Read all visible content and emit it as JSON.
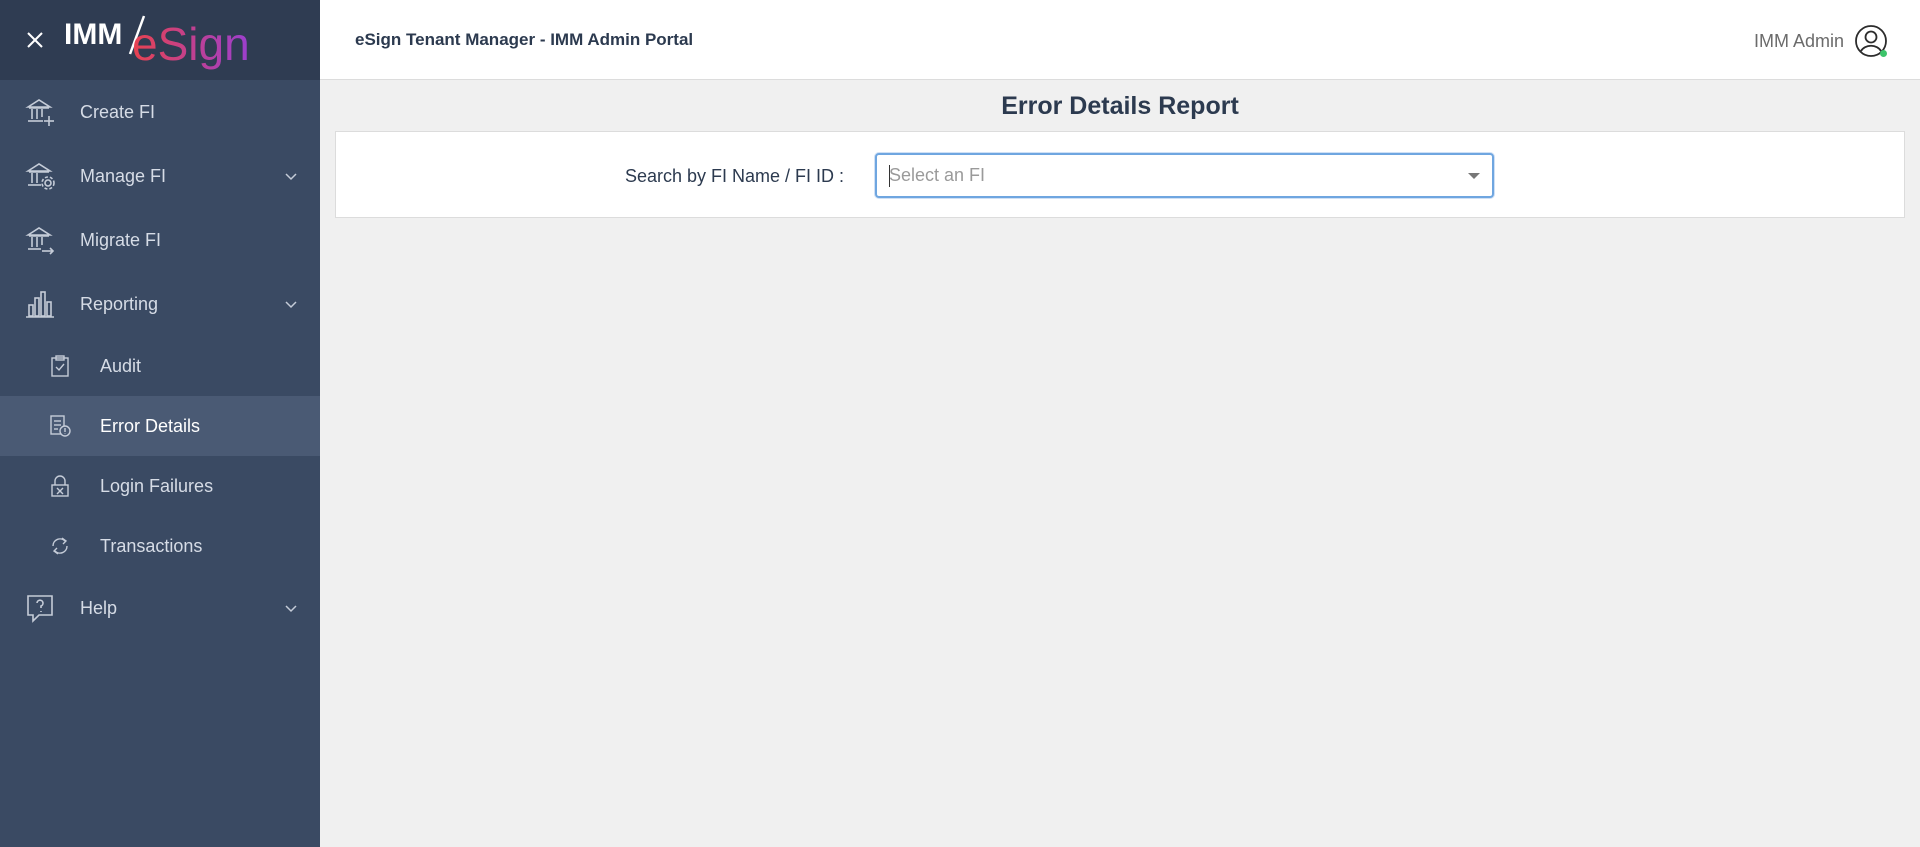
{
  "brand": {
    "part1": "IMM",
    "part2": "eSign",
    "accent_gradient": [
      "#e8424f",
      "#9b3fcf"
    ]
  },
  "colors": {
    "sidebar_bg": "#3a4a63",
    "sidebar_header_bg": "#2f3c52",
    "active_item_bg": "#4a5a74",
    "focus_border": "#6fa6e0",
    "online": "#3cc46a"
  },
  "sidebar": {
    "items": [
      {
        "label": "Create FI",
        "icon": "bank-plus-icon"
      },
      {
        "label": "Manage FI",
        "icon": "bank-gear-icon",
        "expandable": true
      },
      {
        "label": "Migrate FI",
        "icon": "bank-arrow-icon"
      },
      {
        "label": "Reporting",
        "icon": "bar-chart-icon",
        "expandable": true
      },
      {
        "label": "Help",
        "icon": "help-bubble-icon",
        "expandable": true
      }
    ],
    "reporting_subitems": [
      {
        "label": "Audit",
        "icon": "clipboard-check-icon"
      },
      {
        "label": "Error Details",
        "icon": "document-error-icon",
        "active": true
      },
      {
        "label": "Login Failures",
        "icon": "lock-x-icon"
      },
      {
        "label": "Transactions",
        "icon": "cycle-arrows-icon"
      }
    ]
  },
  "header": {
    "app_title": "eSign Tenant Manager - IMM Admin Portal",
    "user_name": "IMM Admin"
  },
  "main": {
    "page_title": "Error Details Report",
    "search_label": "Search by FI Name / FI ID :",
    "search_placeholder": "Select an FI"
  }
}
